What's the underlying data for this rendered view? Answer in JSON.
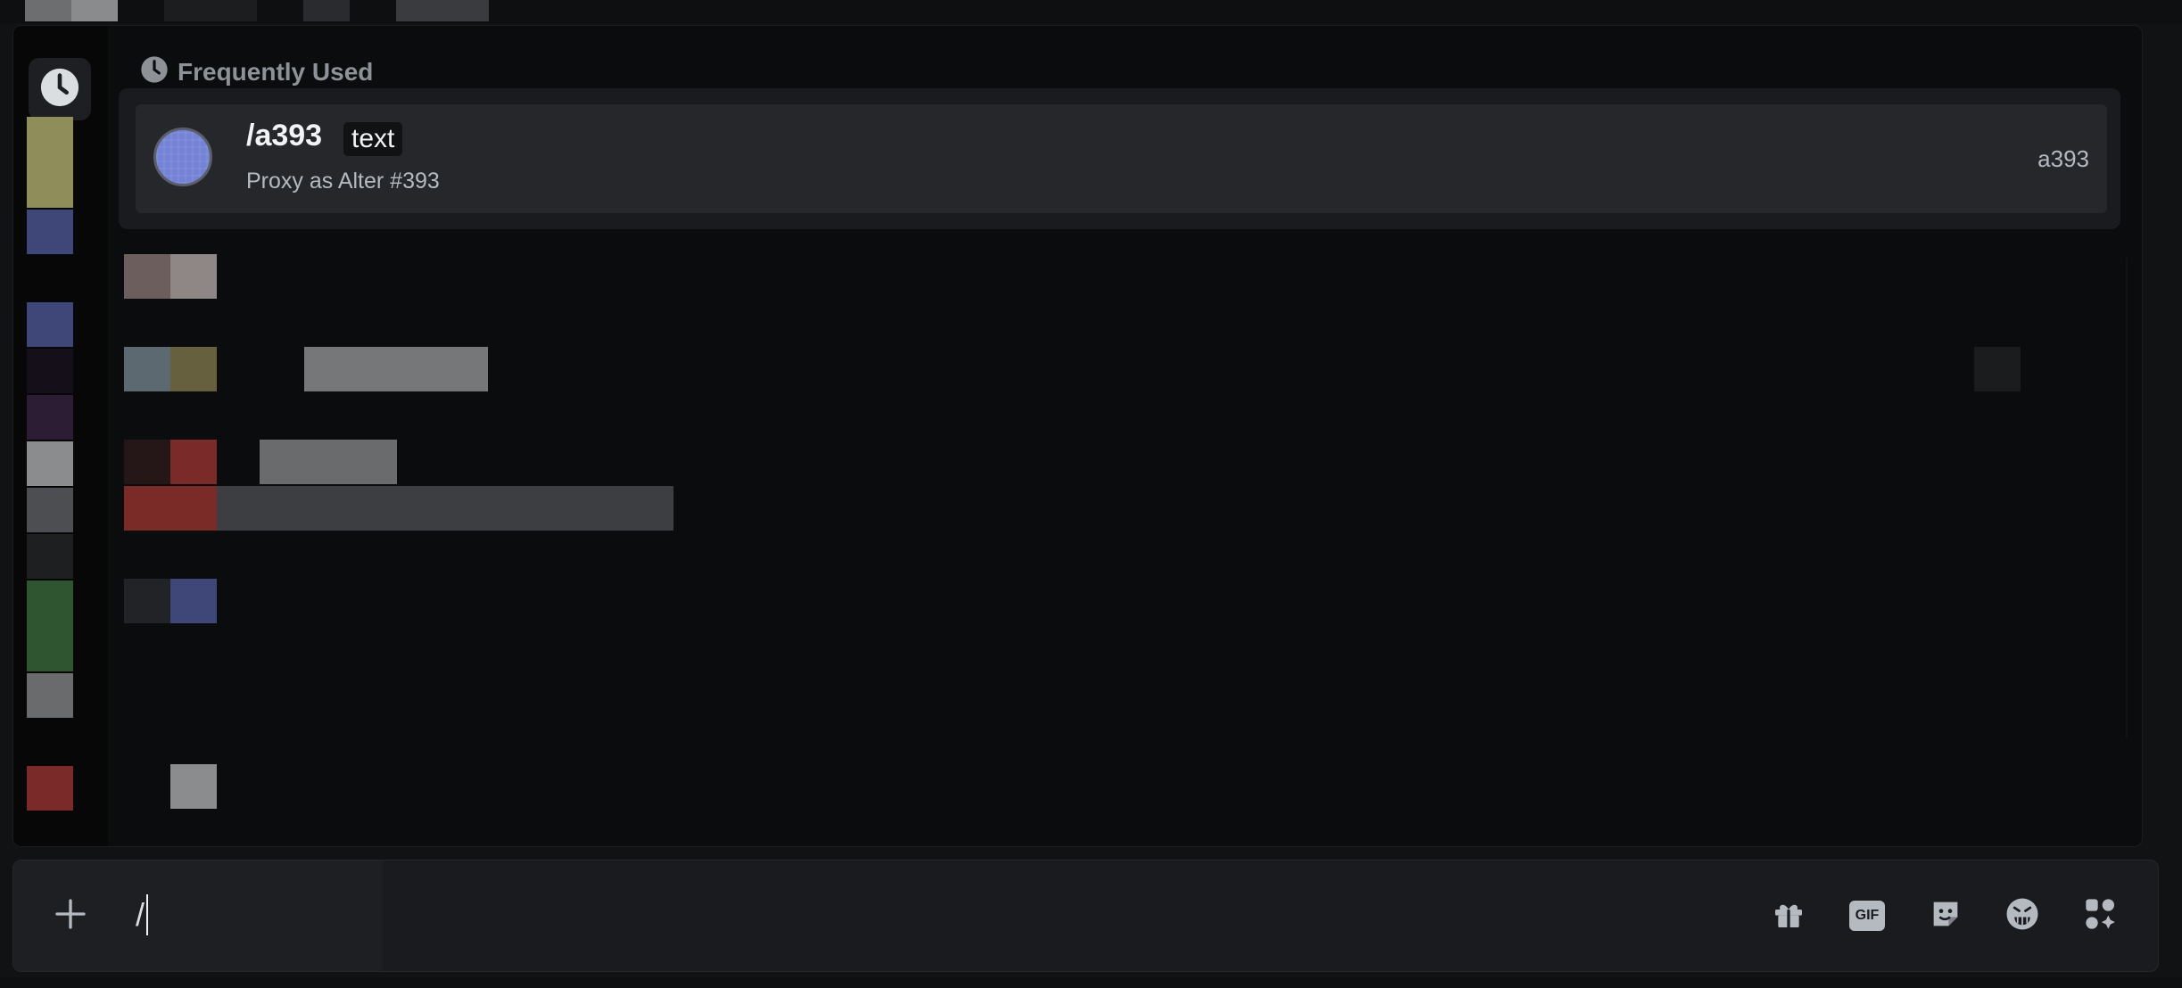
{
  "frequent": {
    "section_title": "Frequently Used",
    "command": {
      "name": "/a393",
      "option": "text",
      "description": "Proxy as Alter #393",
      "source": "a393",
      "avatar_color": "#7583d6"
    }
  },
  "chat": {
    "input_value": "/"
  },
  "icons": {
    "rail_recent": "clock-icon",
    "section": "clock-icon",
    "attach": "plus-icon",
    "gift": "gift-icon",
    "gif": "gif-icon",
    "sticker": "sticker-icon",
    "emoji": "emoji-icon",
    "apps": "apps-icon"
  }
}
